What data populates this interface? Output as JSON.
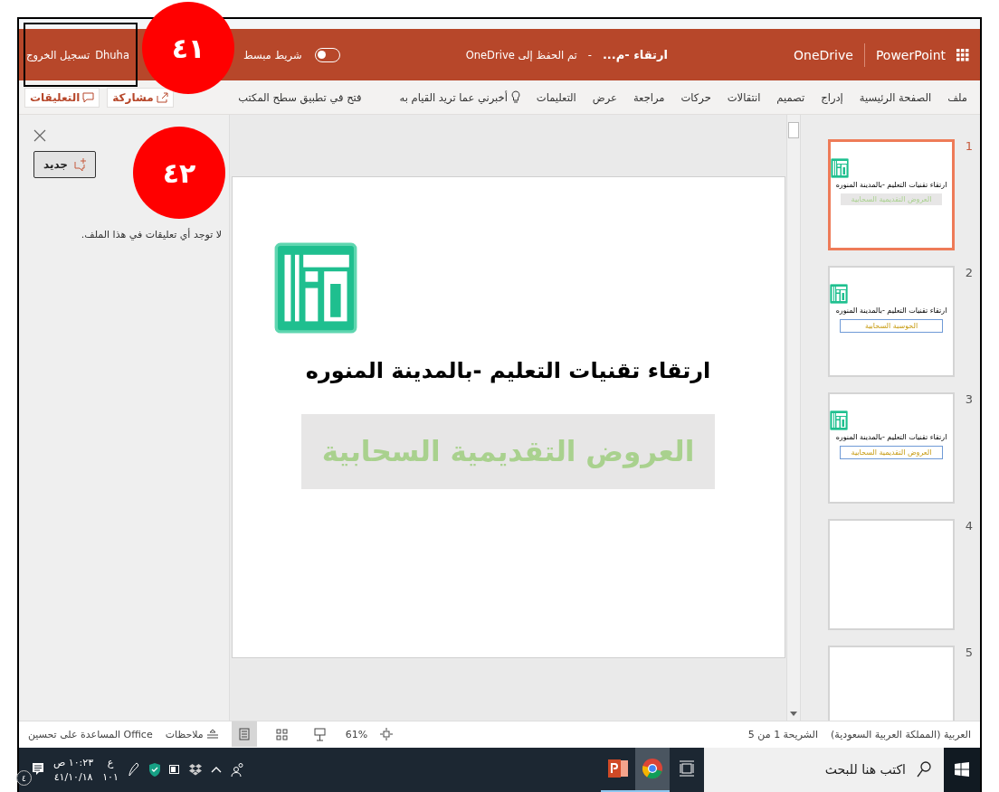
{
  "annotations": [
    {
      "label": "٤١"
    },
    {
      "label": "٤٢"
    }
  ],
  "header": {
    "app_name": "PowerPoint",
    "service": "OneDrive",
    "document_title": "ارتقاء -م...",
    "separator": "-",
    "save_status": "تم الحفظ إلى OneDrive",
    "simplified_ribbon": {
      "label": "شريط مبسط",
      "on": false
    },
    "user_name": "Dhuha",
    "sign_out": "تسجيل الخروج"
  },
  "ribbon": {
    "tabs": [
      {
        "label": "ملف",
        "selected": false
      },
      {
        "label": "الصفحة الرئيسية",
        "selected": false
      },
      {
        "label": "إدراج",
        "selected": false
      },
      {
        "label": "تصميم",
        "selected": false
      },
      {
        "label": "انتقالات",
        "selected": false
      },
      {
        "label": "حركات",
        "selected": false
      },
      {
        "label": "مراجعة",
        "selected": false
      },
      {
        "label": "عرض",
        "selected": false
      },
      {
        "label": "التعليمات",
        "selected": false
      }
    ],
    "tell_me": "أخبرني عما تريد القيام به",
    "open_desktop": "فتح في تطبيق سطح المكتب",
    "share": "مشاركة",
    "comments": "التعليقات"
  },
  "comments_pane": {
    "new_button": "جديد",
    "empty_message": "لا توجد أي تعليقات في هذا الملف."
  },
  "slide": {
    "title": "ارتقاء تقنيات التعليم -بالمدينة المنوره",
    "subtitle": "العروض التقديمية السحابية"
  },
  "thumbnails": [
    {
      "number": "1",
      "selected": true,
      "kind": "shaded",
      "title": "ارتقاء تقنيات التعليم -بالمدينة المنوره",
      "subtitle": "العروض التقديمية السحابية"
    },
    {
      "number": "2",
      "selected": false,
      "kind": "outlined",
      "title": "ارتقاء تقنيات التعليم -بالمدينة المنوره",
      "subtitle": "الحوسبة السحابية"
    },
    {
      "number": "3",
      "selected": false,
      "kind": "outlined",
      "title": "ارتقاء تقنيات التعليم -بالمدينة المنوره",
      "subtitle": "العروض التقديمية السحابية"
    },
    {
      "number": "4",
      "selected": false,
      "kind": "blank"
    },
    {
      "number": "5",
      "selected": false,
      "kind": "blank"
    }
  ],
  "status_bar": {
    "language": "العربية (المملكة العربية السعودية)",
    "slide_position": "الشريحة 1 من 5",
    "help_improve": "المساعدة على تحسين Office",
    "notes": "ملاحظات",
    "zoom": "61%",
    "views": [
      {
        "kind": "normal",
        "selected": true
      },
      {
        "kind": "sorter",
        "selected": false
      },
      {
        "kind": "reading",
        "selected": false
      }
    ]
  },
  "taskbar": {
    "search_placeholder": "اكتب هنا للبحث",
    "apps": [
      {
        "kind": "chrome",
        "selected": true
      },
      {
        "kind": "powerpoint",
        "selected": false
      }
    ],
    "keyboard_layout": "ع",
    "keyboard_layout_code": "١٠١",
    "time": "١٠:٢٣ ص",
    "date": "٤١/١٠/١٨",
    "notification_count": "٤"
  }
}
